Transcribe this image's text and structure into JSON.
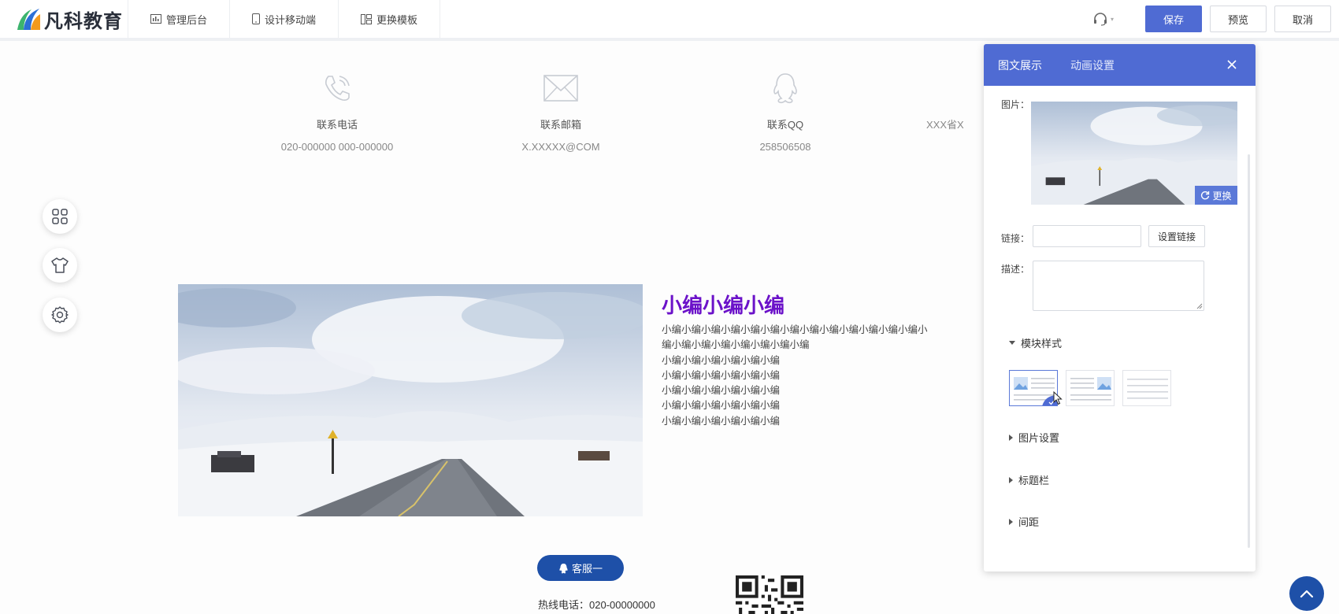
{
  "app": {
    "logo_text": "凡科教育"
  },
  "nav": [
    {
      "label": "管理后台",
      "icon": "bar-chart-icon"
    },
    {
      "label": "设计移动端",
      "icon": "mobile-icon"
    },
    {
      "label": "更换模板",
      "icon": "template-icon"
    }
  ],
  "actions": {
    "save": "保存",
    "preview": "预览",
    "cancel": "取消"
  },
  "contacts": [
    {
      "label": "联系电话",
      "value": "020-000000 000-000000",
      "icon": "phone-icon"
    },
    {
      "label": "联系邮箱",
      "value": "X.XXXXX@COM",
      "icon": "mail-icon"
    },
    {
      "label": "联系QQ",
      "value": "258506508",
      "icon": "qq-icon"
    },
    {
      "label": "",
      "value": "XXX省X",
      "icon": ""
    }
  ],
  "side_tools": [
    "grid-icon",
    "shirt-icon",
    "settings-icon"
  ],
  "content": {
    "title": "小编小编小编",
    "lines": [
      "小编小编小编小编小编小编小编小编小编小编小编小编小编小",
      "编小编小编小编小编小编小编小编",
      "小编小编小编小编小编小编",
      "小编小编小编小编小编小编",
      "小编小编小编小编小编小编",
      "小编小编小编小编小编小编",
      "小编小编小编小编小编小编"
    ]
  },
  "footer": {
    "service_label": "客服一",
    "hotline": "热线电话：020-00000000"
  },
  "panel": {
    "tabs": [
      "图文展示",
      "动画设置"
    ],
    "image_label": "图片：",
    "replace_label": "更换",
    "link_label": "链接：",
    "set_link_label": "设置链接",
    "desc_label": "描述：",
    "sections": {
      "module_style": "模块样式",
      "image_settings": "图片设置",
      "title_bar": "标题栏",
      "spacing": "间距"
    }
  },
  "colors": {
    "accent": "#4f6bd3",
    "title_purple": "#6b12c9",
    "service_blue": "#1e50a8"
  }
}
